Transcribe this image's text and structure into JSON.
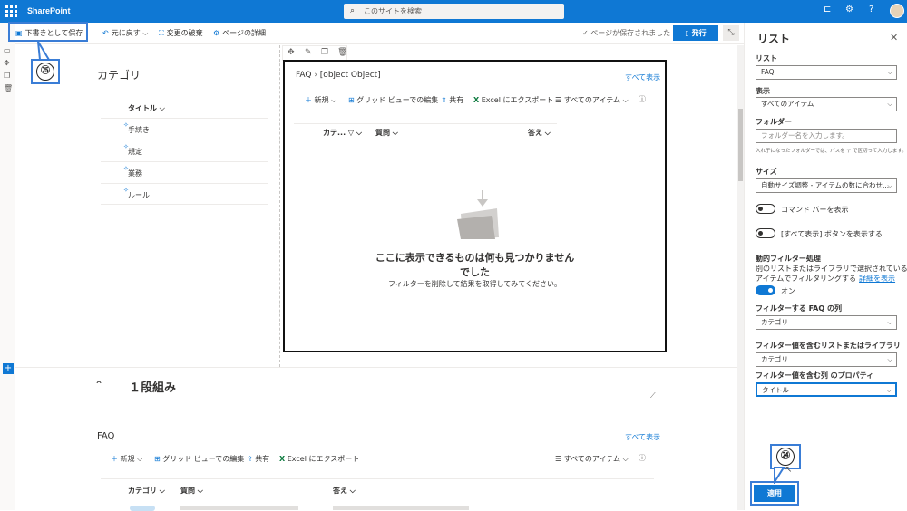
{
  "topbar": {
    "brand": "SharePoint",
    "search_placeholder": "このサイトを検索"
  },
  "cmdbar": {
    "save_draft": "下書きとして保存",
    "undo": "元に戻す",
    "discard": "変更の破棄",
    "page_details": "ページの詳細",
    "saved_status": "ページが保存されました",
    "publish": "発行"
  },
  "callouts": {
    "save": "㉕",
    "apply": "㉔"
  },
  "category": {
    "title": "カテゴリ",
    "column": "タイトル",
    "rows": [
      "手続き",
      "規定",
      "業務",
      "ルール"
    ]
  },
  "faq_webpart": {
    "breadcrumb_root": "FAQ",
    "breadcrumb_child": "[object Object]",
    "see_all": "すべて表示",
    "toolbar": {
      "new": "新規",
      "grid": "グリッド ビューでの編集",
      "share": "共有",
      "excel": "Excel にエクスポート",
      "view": "すべてのアイテム"
    },
    "columns": [
      "カテ...",
      "質問",
      "答え"
    ],
    "empty_line1": "ここに表示できるものは何も見つかりません",
    "empty_line2": "でした",
    "empty_hint": "フィルターを削除して結果を取得してみてください。"
  },
  "section": {
    "title": "１段組み"
  },
  "faq_bottom": {
    "title": "FAQ",
    "see_all": "すべて表示",
    "toolbar": {
      "new": "新規",
      "grid": "グリッド ビューでの編集",
      "share": "共有",
      "excel": "Excel にエクスポート",
      "view": "すべてのアイテム"
    },
    "columns": [
      "カテゴリ",
      "質問",
      "答え"
    ]
  },
  "panel": {
    "title": "リスト",
    "list_label": "リスト",
    "list_value": "FAQ",
    "view_label": "表示",
    "view_value": "すべてのアイテム",
    "folder_label": "フォルダー",
    "folder_placeholder": "フォルダー名を入力します。",
    "folder_hint": "入れ子になったフォルダーでは、パスを '/' で区切って入力します。",
    "size_label": "サイズ",
    "size_value": "自動サイズ調整 - アイテムの数に合わせ...",
    "show_command_bar": "コマンド バーを表示",
    "show_see_all": "[すべて表示] ボタンを表示する",
    "dynamic_filter_label": "動的フィルター処理",
    "dynamic_filter_desc1": "別のリストまたはライブラリで選択されている",
    "dynamic_filter_desc2": "アイテムでフィルタリングする",
    "details_link": "詳細を表示",
    "toggle_on": "オン",
    "filter_column_label": "フィルターする FAQ の列",
    "filter_column_value": "カテゴリ",
    "source_list_label": "フィルター値を含むリストまたはライブラリ",
    "source_list_value": "カテゴリ",
    "source_prop_label": "フィルター値を含む列 のプロパティ",
    "source_prop_value": "タイトル",
    "apply": "適用"
  },
  "colors": {
    "brand": "#0f78d4",
    "callout_border": "#3a7dd6"
  }
}
